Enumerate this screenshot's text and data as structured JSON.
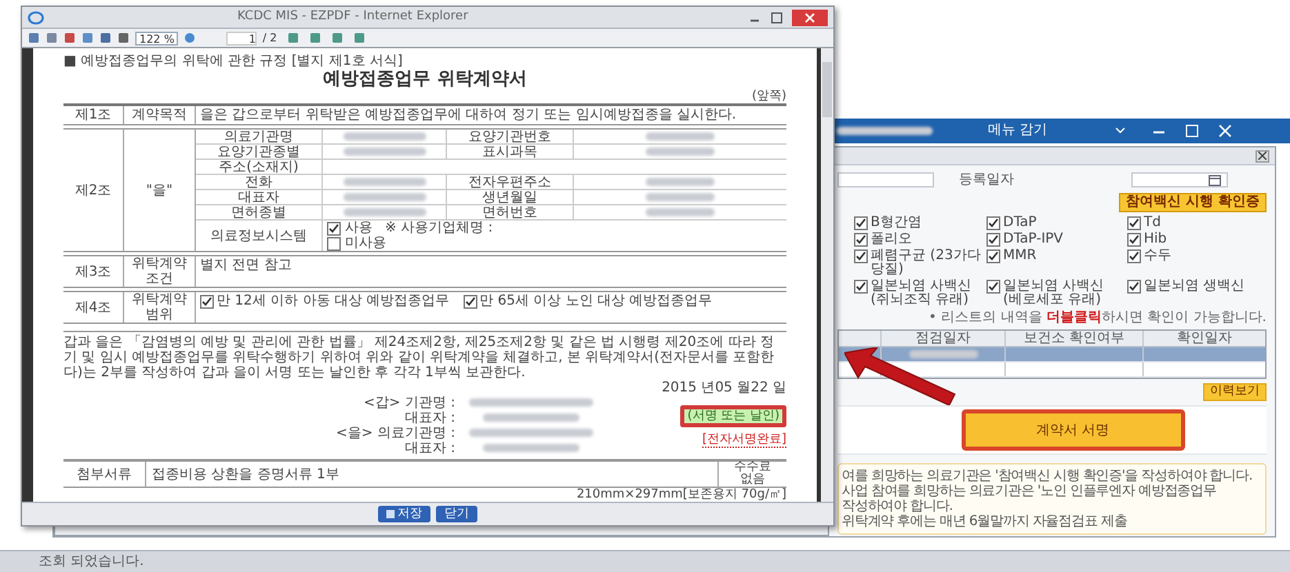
{
  "viewer": {
    "title": "KCDC MIS - EZPDF - Internet Explorer",
    "toolbar": {
      "zoom": "122 %",
      "page": "1",
      "total": "/ 2"
    },
    "document": {
      "header_note": "■ 예방접종업무의 위탁에 관한 규정 [별지 제1호 서식]",
      "title": "예방접종업무 위탁계약서",
      "page_side": "(앞쪽)",
      "articles": [
        {
          "no": "제1조",
          "label": "계약목적",
          "kind": "text",
          "text": "을은 갑으로부터 위탁받은 예방접종업무에 대하여 정기 또는 임시예방접종을 실시한다."
        },
        {
          "no": "제2조",
          "label": "\"을\"",
          "kind": "fields",
          "rows": [
            {
              "cells": [
                "의료기관명",
                "요양기관번호"
              ]
            },
            {
              "cells": [
                "요양기관종별",
                "표시과목"
              ]
            },
            {
              "cells": [
                "주소(소재지)"
              ]
            },
            {
              "cells": [
                "전화",
                "전자우편주소"
              ]
            },
            {
              "cells": [
                "대표자",
                "생년월일"
              ]
            },
            {
              "cells": [
                "면허종별",
                "면허번호"
              ]
            }
          ],
          "system": {
            "label": "의료정보시스템",
            "options": [
              {
                "label": "사용",
                "checked": true,
                "extra": "※ 사용기업체명 :"
              },
              {
                "label": "미사용",
                "checked": false
              }
            ]
          }
        },
        {
          "no": "제3조",
          "label": "위탁계약 조건",
          "kind": "text",
          "text": "별지 전면 참고"
        },
        {
          "no": "제4조",
          "label": "위탁계약 범위",
          "kind": "options",
          "options": [
            {
              "label": "만 12세 이하 아동 대상 예방접종업무",
              "checked": true
            },
            {
              "label": "만 65세 이상 노인 대상 예방접종업무",
              "checked": true
            }
          ]
        }
      ],
      "paragraph": "갑과 을은 「감염병의 예방 및 관리에 관한 법률」 제24조제2항, 제25조제2항 및 같은 법 시행령 제20조에 따라 정기 및 임시 예방접종업무를 위탁수행하기 위하여 위와 같이 위탁계약을 체결하고, 본 위탁계약서(전자문서를 포함한다)는 2부를 작성하여 갑과 을이 서명 또는 날인한 후 각각 1부씩 보관한다.",
      "date": "2015 년05 월22 일",
      "parties": [
        {
          "role": "<갑> 기관명 :",
          "rep": "대표자 :"
        },
        {
          "role": "<을> 의료기관명 :",
          "rep": "대표자 :"
        }
      ],
      "seal": "(서명 또는 날인)",
      "esign": "[전자서명완료]",
      "attachment": {
        "label": "첨부서류",
        "text": "접종비용 상환을 증명서류 1부",
        "fee": [
          "수수료",
          "없음"
        ]
      },
      "paper": "210mm×297mm[보존용지 70g/㎡]"
    },
    "buttons": [
      "저장",
      "닫기"
    ]
  },
  "app": {
    "menu_toggle": "메뉴 감기",
    "form": {
      "date_label": "등록일자",
      "certificate_button": "참여백신 시행 확인증"
    },
    "vaccines": [
      {
        "label": "B형간염",
        "checked": true
      },
      {
        "label": "DTaP",
        "checked": true
      },
      {
        "label": "Td",
        "checked": true
      },
      {
        "label": "폴리오",
        "checked": true
      },
      {
        "label": "DTaP-IPV",
        "checked": true
      },
      {
        "label": "Hib",
        "checked": true
      },
      {
        "label": "폐렴구균 (23가다당질)",
        "checked": true
      },
      {
        "label": "MMR",
        "checked": true
      },
      {
        "label": "수두",
        "checked": true
      },
      {
        "label": "일본뇌염 사백신 (쥐뇌조직 유래)",
        "checked": true
      },
      {
        "label": "일본뇌염 사백신 (베로세포 유래)",
        "checked": true
      },
      {
        "label": "일본뇌염 생백신",
        "checked": true
      }
    ],
    "list_note": "• 리스트의 내역을 **더블클릭**하시면 확인이 가능합니다.",
    "table": {
      "columns": [
        "점검일자",
        "보건소 확인여부",
        "확인일자"
      ],
      "rows": [
        {
          "selected": true
        },
        {
          "selected": false
        }
      ]
    },
    "history_button": "이력보기",
    "sign_button": "계약서 서명",
    "notes": [
      "여를 희망하는 의료기관은 '참여백신 시행 확인증'을 작성하여야 합니다.",
      "사업 참여를 희망하는 의료기관은 '노인 인플루엔자 예방접종업무",
      "작성하여야 합니다.",
      "위탁계약 후에는 매년 6월말까지 자율점검표 제출"
    ]
  },
  "status_bar": "조회 되었습니다."
}
